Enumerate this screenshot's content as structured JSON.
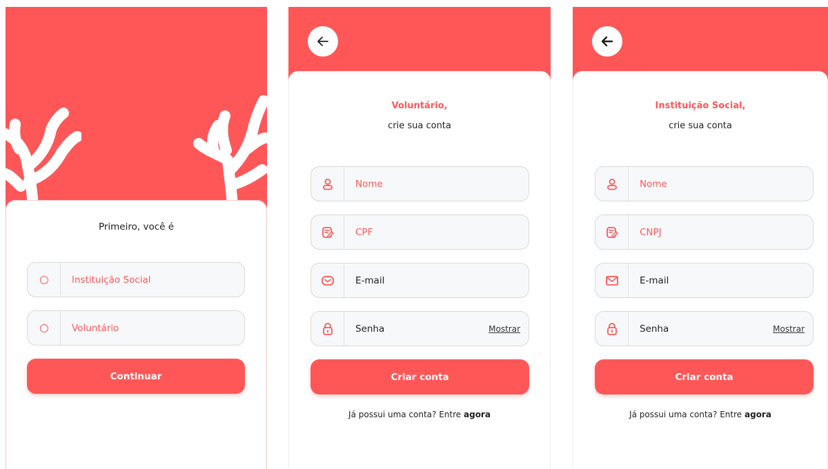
{
  "colors": {
    "accent": "#ff5757",
    "field_bg": "#f7f8fa",
    "field_border": "#d9d9d9",
    "text": "#1f1f1f"
  },
  "screen1": {
    "heading": "Primeiro, você é",
    "options": [
      {
        "label": "Instituição Social",
        "icon": "radio-empty-icon"
      },
      {
        "label": "Voluntário",
        "icon": "radio-empty-icon"
      }
    ],
    "continue_label": "Continuar"
  },
  "screen2": {
    "back_icon": "arrow-left-icon",
    "title": "Voluntário,",
    "subtitle": "crie sua conta",
    "fields": {
      "name": {
        "placeholder": "Nome",
        "icon": "user-icon"
      },
      "doc": {
        "placeholder": "CPF",
        "icon": "document-edit-icon"
      },
      "email": {
        "placeholder": "E-mail",
        "icon": "mail-icon"
      },
      "password": {
        "placeholder": "Senha",
        "icon": "lock-icon",
        "show_label": "Mostrar"
      }
    },
    "submit_label": "Criar conta",
    "footer_text": "Já possui uma conta? Entre",
    "footer_link": "agora"
  },
  "screen3": {
    "back_icon": "arrow-left-icon",
    "title": "Instituição Social,",
    "subtitle": "crie sua conta",
    "fields": {
      "name": {
        "placeholder": "Nome",
        "icon": "user-icon"
      },
      "doc": {
        "placeholder": "CNPJ",
        "icon": "document-edit-icon"
      },
      "email": {
        "placeholder": "E-mail",
        "icon": "mail-icon"
      },
      "password": {
        "placeholder": "Senha",
        "icon": "lock-icon",
        "show_label": "Mostrar"
      }
    },
    "submit_label": "Criar conta",
    "footer_text": "Já possui uma conta? Entre",
    "footer_link": "agora"
  }
}
